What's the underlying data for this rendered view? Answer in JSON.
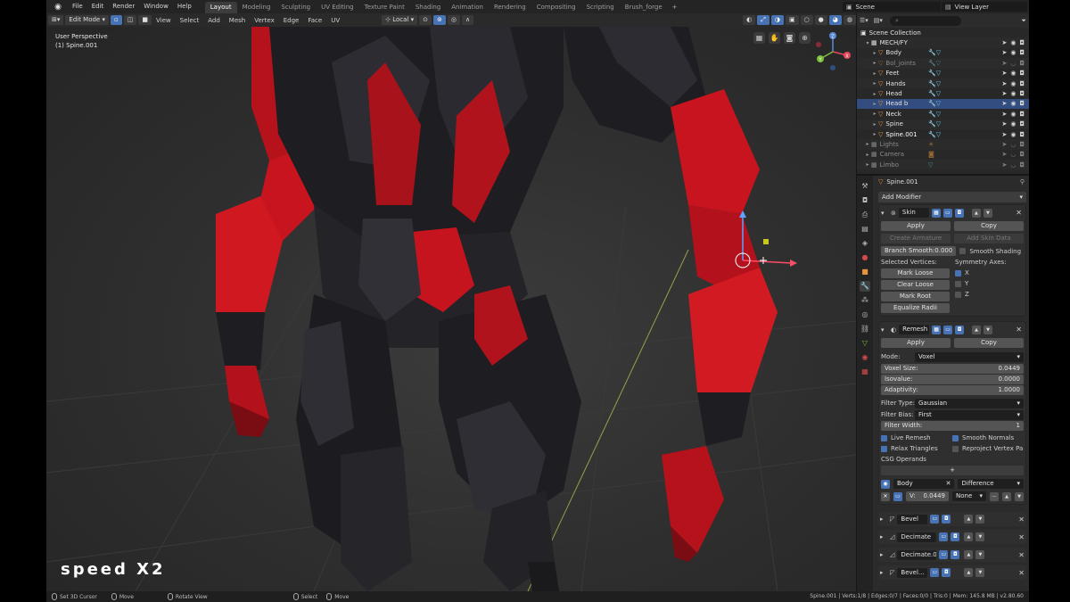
{
  "colors": {
    "accent": "#4772b3",
    "selected_row": "#334d80",
    "object_icon": "#e8923a",
    "armor_red": "#c8141e",
    "armor_dark": "#1e1e22"
  },
  "menu": {
    "items": [
      "File",
      "Edit",
      "Render",
      "Window",
      "Help"
    ],
    "workspaces": [
      "Layout",
      "Modeling",
      "Sculpting",
      "UV Editing",
      "Texture Paint",
      "Shading",
      "Animation",
      "Rendering",
      "Compositing",
      "Scripting",
      "Brush_forge"
    ],
    "scene": "Scene",
    "view_layer": "View Layer"
  },
  "viewport_header": {
    "mode": "Edit Mode",
    "menus": [
      "View",
      "Select",
      "Add",
      "Mesh",
      "Vertex",
      "Edge",
      "Face",
      "UV"
    ],
    "transform": "Local"
  },
  "viewport": {
    "perspective": "User Perspective",
    "object": "(1) Spine.001",
    "overlay_text": "speed X2",
    "gizmo_axes": [
      "X",
      "Y",
      "Z"
    ]
  },
  "outliner": {
    "collection_title": "Scene Collection",
    "rows": [
      {
        "label": "MECH/FY",
        "kind": "collection",
        "dim": false
      },
      {
        "label": "Body",
        "kind": "object",
        "dim": false
      },
      {
        "label": "Bol_joints",
        "kind": "object",
        "dim": true
      },
      {
        "label": "Feet",
        "kind": "object",
        "dim": false
      },
      {
        "label": "Hands",
        "kind": "object",
        "dim": false
      },
      {
        "label": "Head",
        "kind": "object",
        "dim": false
      },
      {
        "label": "Head b",
        "kind": "object",
        "dim": false,
        "selected": true
      },
      {
        "label": "Neck",
        "kind": "object",
        "dim": false
      },
      {
        "label": "Spine",
        "kind": "object",
        "dim": false
      },
      {
        "label": "Spine.001",
        "kind": "object",
        "dim": false
      },
      {
        "label": "Lights",
        "kind": "collection",
        "dim": true
      },
      {
        "label": "Camera",
        "kind": "collection",
        "dim": true
      },
      {
        "label": "Limbo",
        "kind": "collection",
        "dim": true
      }
    ]
  },
  "properties": {
    "object_name": "Spine.001",
    "add_modifier": "Add Modifier",
    "skin": {
      "name": "Skin",
      "apply": "Apply",
      "copy": "Copy",
      "create_armature": "Create Armature",
      "add_skin_data": "Add Skin Data",
      "branch_smooth_label": "Branch Smooth:",
      "branch_smooth_value": "0.000",
      "smooth_shading": "Smooth Shading",
      "selected_vertices": "Selected Vertices:",
      "symmetry_axes": "Symmetry Axes:",
      "mark_loose": "Mark Loose",
      "clear_loose": "Clear Loose",
      "mark_root": "Mark Root",
      "equalize_radii": "Equalize Radii",
      "axis_x": "X",
      "axis_y": "Y",
      "axis_z": "Z"
    },
    "remesh": {
      "name": "Remesh",
      "apply": "Apply",
      "copy": "Copy",
      "mode_label": "Mode:",
      "mode_value": "Voxel",
      "voxel_size_label": "Voxel Size:",
      "voxel_size_value": "0.0449",
      "isovalue_label": "Isovalue:",
      "isovalue_value": "0.0000",
      "adaptivity_label": "Adaptivity:",
      "adaptivity_value": "1.0000",
      "filter_type_label": "Filter Type:",
      "filter_type_value": "Gaussian",
      "filter_bias_label": "Filter Bias:",
      "filter_bias_value": "First",
      "filter_width_label": "Filter Width:",
      "filter_width_value": "1",
      "live_remesh": "Live Remesh",
      "smooth_normals": "Smooth Normals",
      "relax_triangles": "Relax Triangles",
      "reproject": "Reproject Vertex Pa...",
      "csg_operands": "CSG Operands",
      "plus": "+",
      "operand_object": "Body",
      "operand_op": "Difference",
      "operand_v_label": "V:",
      "operand_v_value": "0.0449",
      "operand_none": "None"
    },
    "collapsed_modifiers": [
      "Bevel",
      "Decimate",
      "Decimate.0...",
      "Bevel..."
    ]
  },
  "statusbar": {
    "hints": [
      "Set 3D Cursor",
      "Move",
      "Rotate View",
      "Select",
      "Move"
    ],
    "stats": "Spine.001 | Verts:1/8 | Edges:0/7 | Faces:0/0 | Tris:0 | Mem: 145.8 MB | v2.80.60"
  }
}
